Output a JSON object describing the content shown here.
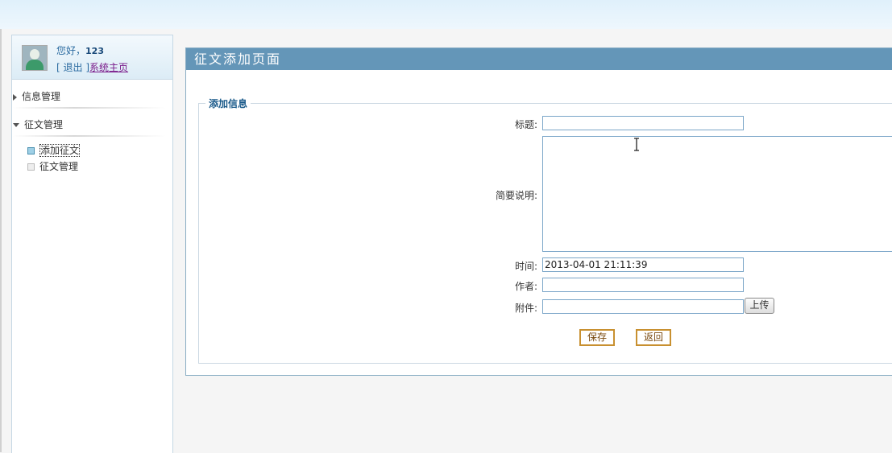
{
  "user": {
    "greeting": "您好，",
    "name": "123",
    "logout_prefix": "[",
    "logout": "退出",
    "logout_suffix": "]",
    "home_link": "系统主页"
  },
  "sidebar": {
    "menus": [
      {
        "label": "信息管理",
        "expanded": false
      },
      {
        "label": "征文管理",
        "expanded": true
      }
    ],
    "sub_items": [
      {
        "label": "添加征文",
        "active": true
      },
      {
        "label": "征文管理",
        "active": false
      }
    ]
  },
  "panel": {
    "title": "征文添加页面",
    "fieldset_legend": "添加信息"
  },
  "form": {
    "title_label": "标题:",
    "title_value": "",
    "summary_label": "简要说明:",
    "summary_value": "",
    "time_label": "时间:",
    "time_value": "2013-04-01 21:11:39",
    "author_label": "作者:",
    "author_value": "",
    "attachment_label": "附件:",
    "attachment_value": "",
    "upload_label": "上传",
    "save_label": "保存",
    "back_label": "返回"
  },
  "icons": {
    "avatar": "user-avatar",
    "cursor": "text-cursor-icon"
  }
}
